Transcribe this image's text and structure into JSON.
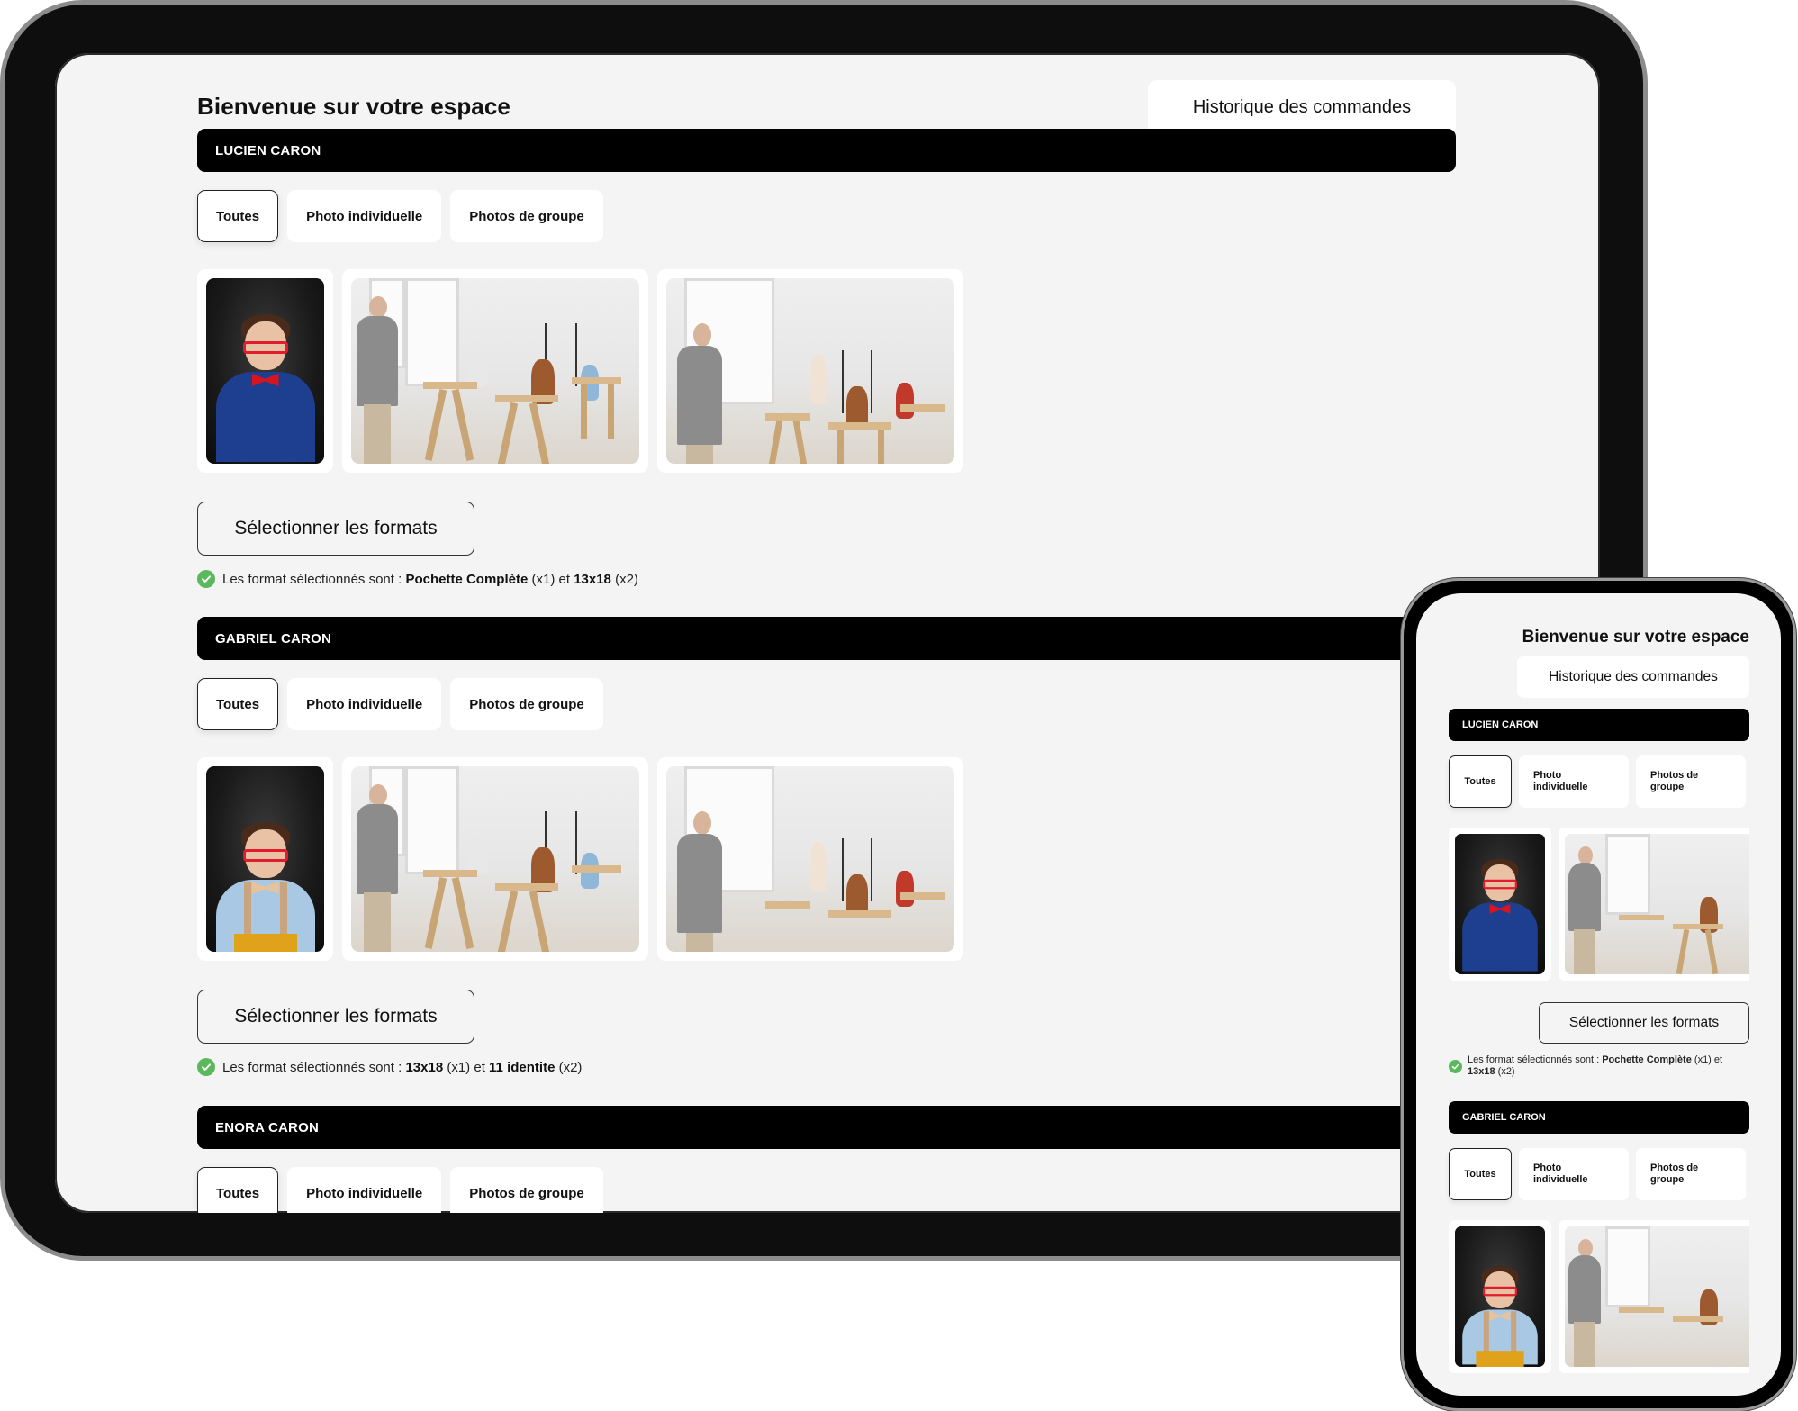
{
  "app": {
    "welcome_title": "Bienvenue sur votre espace",
    "order_history_label": "Historique des commandes"
  },
  "tab_labels": {
    "all": "Toutes",
    "individual": "Photo individuelle",
    "group": "Photos de groupe",
    "individual_line1": "Photo",
    "individual_line2": "individuelle",
    "group_line1": "Photos de",
    "group_line2": "groupe"
  },
  "active_tab": "Toutes",
  "select_formats_label": "Sélectionner les formats",
  "formats_prefix": "Les format sélectionnés sont :",
  "formats_joiner": "et",
  "colors": {
    "name_bar": "#000000",
    "background": "#f4f4f4",
    "check": "#5cb85c"
  },
  "children": [
    {
      "name": "LUCIEN CARON",
      "photos": [
        "portrait-boy-blue-shirt-red-bowtie",
        "classroom-group-1",
        "classroom-group-2"
      ],
      "formats": [
        {
          "name": "Pochette Complète",
          "qty": "(x1)"
        },
        {
          "name": "13x18",
          "qty": "(x2)"
        }
      ]
    },
    {
      "name": "GABRIEL CARON",
      "photos": [
        "portrait-boy-suspenders-pointing",
        "classroom-group-1",
        "classroom-group-2"
      ],
      "formats": [
        {
          "name": "13x18",
          "qty": "(x1)"
        },
        {
          "name": "11 identite",
          "qty": "(x2)"
        }
      ]
    },
    {
      "name": "ENORA CARON"
    }
  ]
}
